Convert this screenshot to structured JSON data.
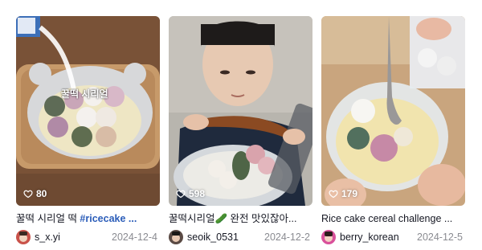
{
  "posts": [
    {
      "likes": "80",
      "caption": "꿀떡 시리얼 떡 ",
      "hashtag": "#ricecake ...",
      "author": "s_x.yi",
      "date": "2024-12-4",
      "overlay_text": "꿀떡 시리얼"
    },
    {
      "likes": "598",
      "caption": "꿀떡시리얼🥒 완전 맛있잖아...",
      "hashtag": "",
      "author": "seoik_0531",
      "date": "2024-12-2"
    },
    {
      "likes": "179",
      "caption": "Rice cake cereal challenge ...",
      "hashtag": "",
      "author": "berry_korean",
      "date": "2024-12-5"
    }
  ],
  "icons": {
    "likes": "heart-outline-icon"
  },
  "colors": {
    "hashtag": "#2b5db9",
    "date": "#8a8b91"
  }
}
